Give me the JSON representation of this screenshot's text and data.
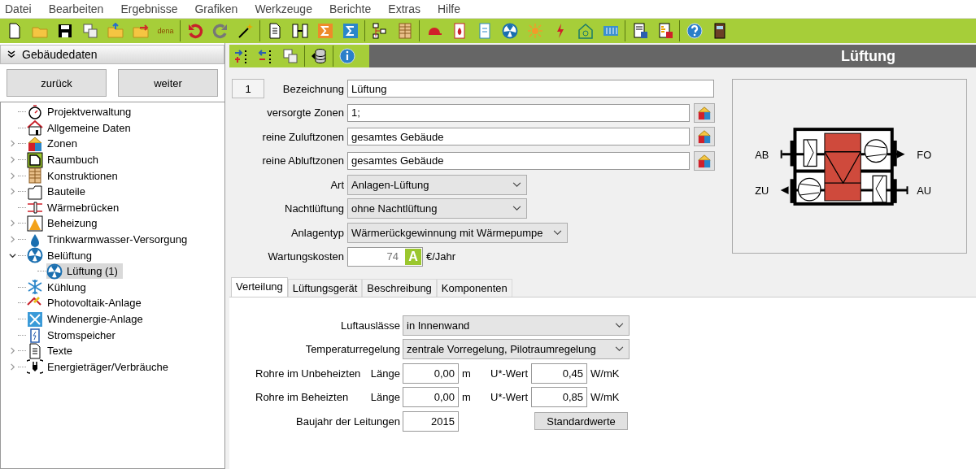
{
  "menu": [
    "Datei",
    "Bearbeiten",
    "Ergebnisse",
    "Grafiken",
    "Werkzeuge",
    "Berichte",
    "Extras",
    "Hilfe"
  ],
  "toolbar": {
    "dena_label": "dena"
  },
  "sidebar": {
    "title": "Gebäudedaten",
    "buttons": [
      "zurück",
      "weiter"
    ],
    "tree": [
      {
        "kind": "leaf",
        "label": "Projektverwaltung",
        "selected": false
      },
      {
        "kind": "leaf",
        "label": "Allgemeine Daten",
        "selected": false
      },
      {
        "kind": "folder",
        "label": "Zonen",
        "expanded": false,
        "selected": false
      },
      {
        "kind": "folder",
        "label": "Raumbuch",
        "expanded": false,
        "selected": false
      },
      {
        "kind": "folder",
        "label": "Konstruktionen",
        "expanded": false,
        "selected": false
      },
      {
        "kind": "folder",
        "label": "Bauteile",
        "expanded": false,
        "selected": false
      },
      {
        "kind": "leaf",
        "label": "Wärmebrücken",
        "selected": false
      },
      {
        "kind": "folder",
        "label": "Beheizung",
        "expanded": false,
        "selected": false
      },
      {
        "kind": "folder",
        "label": "Trinkwarmwasser-Versorgung",
        "expanded": false,
        "selected": false
      },
      {
        "kind": "folder",
        "label": "Belüftung",
        "expanded": true,
        "selected": false,
        "children": [
          {
            "label": "Lüftung (1)",
            "selected": true
          }
        ]
      },
      {
        "kind": "leaf",
        "label": "Kühlung",
        "selected": false
      },
      {
        "kind": "leaf",
        "label": "Photovoltaik-Anlage",
        "selected": false
      },
      {
        "kind": "leaf",
        "label": "Windenergie-Anlage",
        "selected": false
      },
      {
        "kind": "leaf",
        "label": "Stromspeicher",
        "selected": false
      },
      {
        "kind": "folder",
        "label": "Texte",
        "expanded": false,
        "selected": false
      },
      {
        "kind": "folder",
        "label": "Energieträger/Verbräuche",
        "expanded": false,
        "selected": false
      }
    ]
  },
  "page_title": "Lüftung",
  "form": {
    "number": "1",
    "fields": [
      {
        "kind": "text",
        "label": "Bezeichnung",
        "value": "Lüftung"
      },
      {
        "kind": "zone",
        "label": "versorgte Zonen",
        "value": "1;"
      },
      {
        "kind": "zone",
        "label": "reine Zuluftzonen",
        "value": "gesamtes Gebäude"
      },
      {
        "kind": "zone",
        "label": "reine Abluftzonen",
        "value": "gesamtes Gebäude"
      },
      {
        "kind": "select",
        "label": "Art",
        "value": "Anlagen-Lüftung"
      },
      {
        "kind": "select",
        "label": "Nachtlüftung",
        "value": "ohne Nachtlüftung"
      },
      {
        "kind": "select",
        "label": "Anlagentyp",
        "value": "Wärmerückgewinnung mit Wärmepumpe"
      },
      {
        "kind": "cost",
        "label": "Wartungskosten",
        "value": "74",
        "badge": "A",
        "unit": "€/Jahr"
      }
    ]
  },
  "diagram": {
    "labels": [
      "AB",
      "FO",
      "ZU",
      "AU"
    ]
  },
  "tabs": [
    {
      "label": "Verteilung",
      "selected": true
    },
    {
      "label": "Lüftungsgerät",
      "selected": false
    },
    {
      "label": "Beschreibung",
      "selected": false
    },
    {
      "label": "Komponenten",
      "selected": false
    }
  ],
  "distribution": {
    "selects": [
      {
        "label": "Luftauslässe",
        "value": "in Innenwand"
      },
      {
        "label": "Temperaturregelung",
        "value": "zentrale Vorregelung, Pilotraumregelung"
      }
    ],
    "pipes": [
      {
        "label": "Rohre im Unbeheizten",
        "length_label": "Länge",
        "length": "0,00",
        "length_unit": "m",
        "u_label": "U*-Wert",
        "u": "0,45",
        "u_unit": "W/mK"
      },
      {
        "label": "Rohre im Beheizten",
        "length_label": "Länge",
        "length": "0,00",
        "length_unit": "m",
        "u_label": "U*-Wert",
        "u": "0,85",
        "u_unit": "W/mK"
      }
    ],
    "year": {
      "label": "Baujahr der Leitungen",
      "value": "2015"
    },
    "button": "Standardwerte"
  }
}
